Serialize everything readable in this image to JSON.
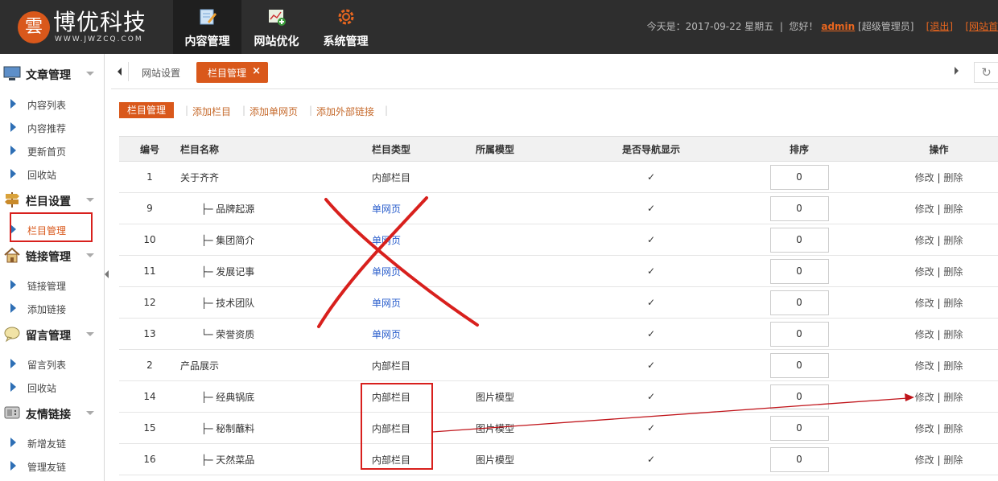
{
  "brand": {
    "mark": "雲",
    "name": "博优科技",
    "url": "WWW.JWZCQ.COM"
  },
  "top_nav": [
    {
      "label": "内容管理",
      "icon": "edit-icon"
    },
    {
      "label": "网站优化",
      "icon": "chart-icon"
    },
    {
      "label": "系统管理",
      "icon": "gear-icon"
    }
  ],
  "top_info": {
    "today_prefix": "今天是：2017-09-22 星期五",
    "greeting": "您好！",
    "user": "admin",
    "role": "[超级管理员]",
    "logout": "[退出]",
    "site_home": "[网站首"
  },
  "sidebar": {
    "groups": [
      {
        "title": "文章管理",
        "items": [
          "内容列表",
          "内容推荐",
          "更新首页",
          "回收站"
        ]
      },
      {
        "title": "栏目设置",
        "items": [
          "栏目管理"
        ]
      },
      {
        "title": "链接管理",
        "items": [
          "链接管理",
          "添加链接"
        ]
      },
      {
        "title": "留言管理",
        "items": [
          "留言列表",
          "回收站"
        ]
      },
      {
        "title": "友情链接",
        "items": [
          "新增友链",
          "管理友链"
        ]
      }
    ]
  },
  "tabs": {
    "site": "网站设置",
    "active": "栏目管理",
    "close": "×",
    "refresh": "↻"
  },
  "submenu": {
    "active": "栏目管理",
    "links": [
      "添加栏目",
      "添加单网页",
      "添加外部链接"
    ],
    "sep": "|"
  },
  "table": {
    "headers": [
      "编号",
      "栏目名称",
      "栏目类型",
      "所属模型",
      "是否导航显示",
      "排序",
      "操作"
    ],
    "rows": [
      {
        "id": "1",
        "name": "关于齐齐",
        "prefix": "",
        "type": "内部栏目",
        "type_link": false,
        "model": "",
        "nav": "✓",
        "order": "0"
      },
      {
        "id": "9",
        "name": "品牌起源",
        "prefix": "├─ ",
        "type": "单网页",
        "type_link": true,
        "model": "",
        "nav": "✓",
        "order": "0"
      },
      {
        "id": "10",
        "name": "集团简介",
        "prefix": "├─ ",
        "type": "单网页",
        "type_link": true,
        "model": "",
        "nav": "✓",
        "order": "0"
      },
      {
        "id": "11",
        "name": "发展记事",
        "prefix": "├─ ",
        "type": "单网页",
        "type_link": true,
        "model": "",
        "nav": "✓",
        "order": "0"
      },
      {
        "id": "12",
        "name": "技术团队",
        "prefix": "├─ ",
        "type": "单网页",
        "type_link": true,
        "model": "",
        "nav": "✓",
        "order": "0"
      },
      {
        "id": "13",
        "name": "荣誉资质",
        "prefix": "└─ ",
        "type": "单网页",
        "type_link": true,
        "model": "",
        "nav": "✓",
        "order": "0"
      },
      {
        "id": "2",
        "name": "产品展示",
        "prefix": "",
        "type": "内部栏目",
        "type_link": false,
        "model": "",
        "nav": "✓",
        "order": "0"
      },
      {
        "id": "14",
        "name": "经典锅底",
        "prefix": "├─ ",
        "type": "内部栏目",
        "type_link": false,
        "model": "图片模型",
        "nav": "✓",
        "order": "0"
      },
      {
        "id": "15",
        "name": "秘制蘸料",
        "prefix": "├─ ",
        "type": "内部栏目",
        "type_link": false,
        "model": "图片模型",
        "nav": "✓",
        "order": "0"
      },
      {
        "id": "16",
        "name": "天然菜品",
        "prefix": "├─ ",
        "type": "内部栏目",
        "type_link": false,
        "model": "图片模型",
        "nav": "✓",
        "order": "0"
      }
    ],
    "edit_label": "修改",
    "op_sep": "|",
    "delete_label": "删除"
  },
  "colors": {
    "accent": "#d9581b",
    "topbar": "#2e2e2e",
    "annotation": "#d8201d",
    "check": "#1d9c2f"
  }
}
